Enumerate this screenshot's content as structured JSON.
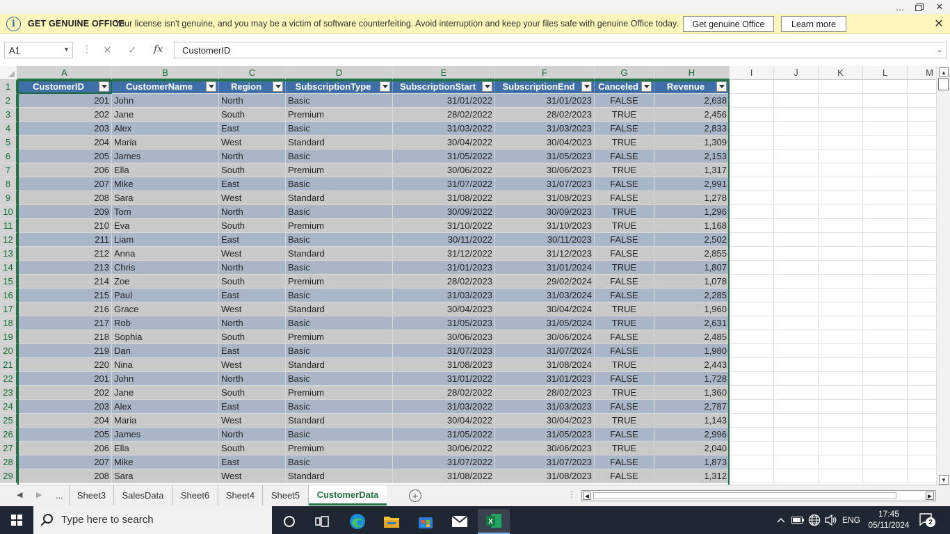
{
  "window": {
    "more_icon": "…",
    "restore_icon": "restore-icon",
    "close_icon": "✕"
  },
  "banner": {
    "title": "GET GENUINE OFFICE",
    "message": "Your license isn't genuine, and you may be a victim of software counterfeiting. Avoid interruption and keep your files safe with genuine Office today.",
    "primary_button": "Get genuine Office",
    "secondary_button": "Learn more"
  },
  "formula_bar": {
    "name_box": "A1",
    "fx_label": "fx",
    "value": "CustomerID"
  },
  "columns": [
    "A",
    "B",
    "C",
    "D",
    "E",
    "F",
    "G",
    "H",
    "I",
    "J",
    "K",
    "L",
    "M"
  ],
  "table": {
    "headers": [
      "CustomerID",
      "CustomerName",
      "Region",
      "SubscriptionType",
      "SubscriptionStart",
      "SubscriptionEnd",
      "Canceled",
      "Revenue"
    ],
    "rows": [
      [
        "201",
        "John",
        "North",
        "Basic",
        "31/01/2022",
        "31/01/2023",
        "FALSE",
        "2,638"
      ],
      [
        "202",
        "Jane",
        "South",
        "Premium",
        "28/02/2022",
        "28/02/2023",
        "TRUE",
        "2,456"
      ],
      [
        "203",
        "Alex",
        "East",
        "Basic",
        "31/03/2022",
        "31/03/2023",
        "FALSE",
        "2,833"
      ],
      [
        "204",
        "Maria",
        "West",
        "Standard",
        "30/04/2022",
        "30/04/2023",
        "TRUE",
        "1,309"
      ],
      [
        "205",
        "James",
        "North",
        "Basic",
        "31/05/2022",
        "31/05/2023",
        "FALSE",
        "2,153"
      ],
      [
        "206",
        "Ella",
        "South",
        "Premium",
        "30/06/2022",
        "30/06/2023",
        "TRUE",
        "1,317"
      ],
      [
        "207",
        "Mike",
        "East",
        "Basic",
        "31/07/2022",
        "31/07/2023",
        "FALSE",
        "2,991"
      ],
      [
        "208",
        "Sara",
        "West",
        "Standard",
        "31/08/2022",
        "31/08/2023",
        "FALSE",
        "1,278"
      ],
      [
        "209",
        "Tom",
        "North",
        "Basic",
        "30/09/2022",
        "30/09/2023",
        "TRUE",
        "1,296"
      ],
      [
        "210",
        "Eva",
        "South",
        "Premium",
        "31/10/2022",
        "31/10/2023",
        "TRUE",
        "1,168"
      ],
      [
        "211",
        "Liam",
        "East",
        "Basic",
        "30/11/2022",
        "30/11/2023",
        "FALSE",
        "2,502"
      ],
      [
        "212",
        "Anna",
        "West",
        "Standard",
        "31/12/2022",
        "31/12/2023",
        "FALSE",
        "2,855"
      ],
      [
        "213",
        "Chris",
        "North",
        "Basic",
        "31/01/2023",
        "31/01/2024",
        "TRUE",
        "1,807"
      ],
      [
        "214",
        "Zoe",
        "South",
        "Premium",
        "28/02/2023",
        "29/02/2024",
        "FALSE",
        "1,078"
      ],
      [
        "215",
        "Paul",
        "East",
        "Basic",
        "31/03/2023",
        "31/03/2024",
        "FALSE",
        "2,285"
      ],
      [
        "216",
        "Grace",
        "West",
        "Standard",
        "30/04/2023",
        "30/04/2024",
        "TRUE",
        "1,960"
      ],
      [
        "217",
        "Rob",
        "North",
        "Basic",
        "31/05/2023",
        "31/05/2024",
        "TRUE",
        "2,631"
      ],
      [
        "218",
        "Sophia",
        "South",
        "Premium",
        "30/06/2023",
        "30/06/2024",
        "FALSE",
        "2,485"
      ],
      [
        "219",
        "Dan",
        "East",
        "Basic",
        "31/07/2023",
        "31/07/2024",
        "FALSE",
        "1,980"
      ],
      [
        "220",
        "Nina",
        "West",
        "Standard",
        "31/08/2023",
        "31/08/2024",
        "TRUE",
        "2,443"
      ],
      [
        "201",
        "John",
        "North",
        "Basic",
        "31/01/2022",
        "31/01/2023",
        "FALSE",
        "1,728"
      ],
      [
        "202",
        "Jane",
        "South",
        "Premium",
        "28/02/2022",
        "28/02/2023",
        "TRUE",
        "1,360"
      ],
      [
        "203",
        "Alex",
        "East",
        "Basic",
        "31/03/2022",
        "31/03/2023",
        "FALSE",
        "2,787"
      ],
      [
        "204",
        "Maria",
        "West",
        "Standard",
        "30/04/2022",
        "30/04/2023",
        "TRUE",
        "1,143"
      ],
      [
        "205",
        "James",
        "North",
        "Basic",
        "31/05/2022",
        "31/05/2023",
        "FALSE",
        "2,996"
      ],
      [
        "206",
        "Ella",
        "South",
        "Premium",
        "30/06/2022",
        "30/06/2023",
        "TRUE",
        "2,040"
      ],
      [
        "207",
        "Mike",
        "East",
        "Basic",
        "31/07/2022",
        "31/07/2023",
        "FALSE",
        "1,873"
      ],
      [
        "208",
        "Sara",
        "West",
        "Standard",
        "31/08/2022",
        "31/08/2023",
        "FALSE",
        "1,312"
      ]
    ]
  },
  "row_numbers": [
    "1",
    "2",
    "3",
    "4",
    "5",
    "6",
    "7",
    "8",
    "9",
    "10",
    "11",
    "12",
    "13",
    "14",
    "15",
    "16",
    "17",
    "18",
    "19",
    "20",
    "21",
    "22",
    "23",
    "24",
    "25",
    "26",
    "27",
    "28",
    "29"
  ],
  "sheet_tabs": {
    "overflow": "...",
    "tabs": [
      "Sheet3",
      "SalesData",
      "Sheet6",
      "Sheet4",
      "Sheet5",
      "CustomerData"
    ],
    "active": "CustomerData",
    "add": "+"
  },
  "taskbar": {
    "search_placeholder": "Type here to search",
    "language": "ENG",
    "time": "17:45",
    "date": "05/11/2024",
    "notifications": "2"
  },
  "colors": {
    "accent": "#217346",
    "table_header": "#3f6fa8",
    "band_blue": "#a9b6c8",
    "band_gray": "#c9c9c9",
    "banner_bg": "#fdf6bc"
  }
}
